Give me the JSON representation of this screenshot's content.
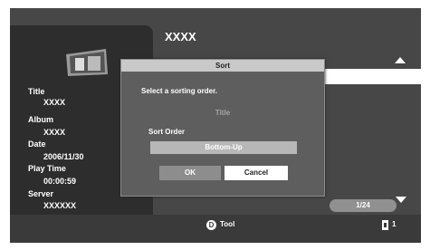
{
  "header": {
    "title": "XXXX"
  },
  "details": [
    {
      "label": "Title",
      "value": "XXXX"
    },
    {
      "label": "Album",
      "value": "XXXX"
    },
    {
      "label": "Date",
      "value": "2006/11/30"
    },
    {
      "label": "Play Time",
      "value": "00:00:59"
    },
    {
      "label": "Server",
      "value": "XXXXXX"
    }
  ],
  "list": {
    "page_counter": "1/24"
  },
  "footer": {
    "tool_key": "D",
    "tool_label": "Tool",
    "device_count": "1"
  },
  "dialog": {
    "title": "Sort",
    "message": "Select a sorting order.",
    "sort_field": "Title",
    "sort_order_label": "Sort Order",
    "sort_order_value": "Bottom-Up",
    "ok_label": "OK",
    "cancel_label": "Cancel"
  },
  "colors": {
    "screen_bg": "#474747",
    "panel_bg": "#2d2d2d",
    "dialog_bg": "#5e5e5e",
    "dialog_titlebar": "#c9c9c9"
  }
}
